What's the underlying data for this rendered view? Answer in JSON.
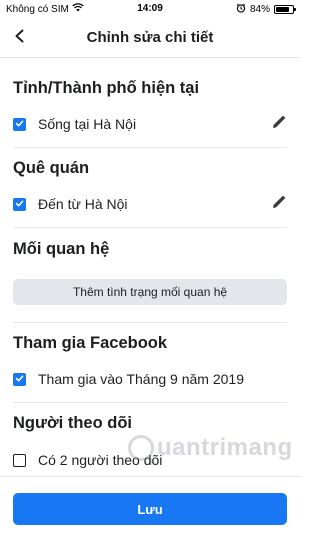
{
  "status_bar": {
    "carrier": "Không có SIM",
    "time": "14:09",
    "battery_percent": "84%",
    "battery_level": 0.84
  },
  "header": {
    "title": "Chỉnh sửa chi tiết"
  },
  "sections": {
    "current_city": {
      "title": "Tỉnh/Thành phố hiện tại",
      "item_label": "Sống tại Hà Nội",
      "checked": true
    },
    "hometown": {
      "title": "Quê quán",
      "item_label": "Đến từ Hà Nội",
      "checked": true
    },
    "relationship": {
      "title": "Mối quan hệ",
      "add_button_label": "Thêm tình trạng mối quan hệ"
    },
    "joined": {
      "title": "Tham gia Facebook",
      "item_label": "Tham gia vào Tháng 9 năm 2019",
      "checked": true
    },
    "followers": {
      "title": "Người theo dõi",
      "item_label": "Có 2 người theo dõi",
      "checked": false
    }
  },
  "footer": {
    "save_label": "Lưu"
  },
  "watermark": {
    "text": "uantrimang"
  },
  "colors": {
    "accent": "#1877f2",
    "divider": "#e4e6eb",
    "text": "#1c1e21"
  },
  "icons": [
    "wifi-icon",
    "alarm-icon",
    "back-arrow-icon",
    "checkmark-icon",
    "pencil-icon"
  ]
}
